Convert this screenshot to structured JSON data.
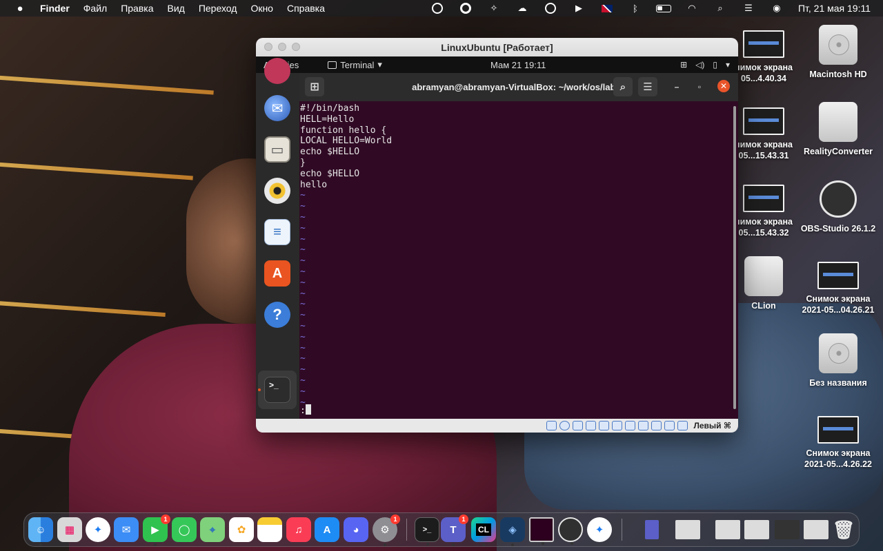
{
  "menubar": {
    "app_name": "Finder",
    "items": [
      "Файл",
      "Правка",
      "Вид",
      "Переход",
      "Окно",
      "Справка"
    ],
    "clock": "Пт, 21 мая  19:11",
    "battery_level": 0.35
  },
  "vbox": {
    "title": "LinuxUbuntu [Работает]",
    "host_key": "Левый ⌘"
  },
  "ubuntu": {
    "activities": "Activities",
    "app_menu": "Terminal",
    "date": "Мам 21  19:11"
  },
  "terminal": {
    "title": "abramyan@abramyan-VirtualBox: ~/work/os/lab06",
    "lines": [
      "#!/bin/bash",
      "HELL=Hello",
      "function hello {",
      "LOCAL HELLO=World",
      "echo $HELLO",
      "}",
      "echo $HELLO",
      "hello"
    ],
    "tilde": "~",
    "prompt": ":"
  },
  "desktop": {
    "icons": [
      {
        "label": "нимок экрана",
        "sub": "05...4.40.34"
      },
      {
        "label": "нимок экрана",
        "sub": "05...15.43.31"
      },
      {
        "label": "нимок экрана",
        "sub": "05...15.43.32"
      },
      {
        "label": "CLion",
        "sub": ""
      },
      {
        "label": "Macintosh HD",
        "sub": ""
      },
      {
        "label": "RealityConverter",
        "sub": ""
      },
      {
        "label": "OBS-Studio 26.1.2",
        "sub": ""
      },
      {
        "label": "Снимок экрана",
        "sub": "2021-05...04.26.21"
      },
      {
        "label": "Без названия",
        "sub": ""
      },
      {
        "label": "Снимок экрана",
        "sub": "2021-05...4.26.22"
      }
    ]
  },
  "dock": {
    "facetime_badge": "1",
    "settings_badge": "1",
    "teams_badge": "1",
    "clion_label": "CL"
  }
}
